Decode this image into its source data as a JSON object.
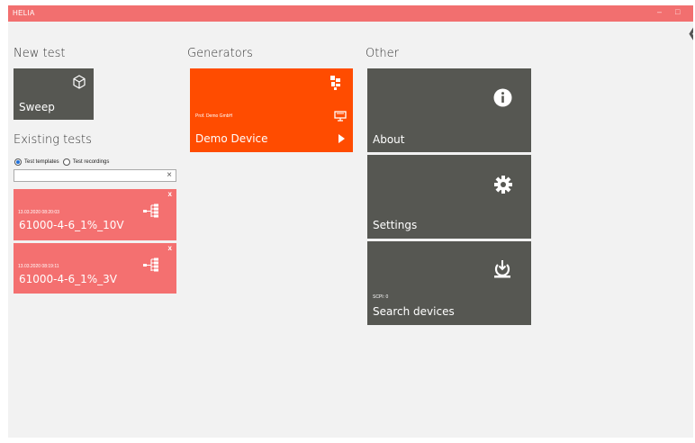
{
  "app": {
    "title": "HELIA",
    "minimize": "–",
    "maximize": "□"
  },
  "new_test": {
    "heading": "New test",
    "sweep_label": "Sweep"
  },
  "existing_tests": {
    "heading": "Existing tests",
    "radio_templates": "Test templates",
    "radio_recordings": "Test recordings",
    "search_value": "",
    "clear_icon": "×",
    "cards": [
      {
        "date": "13.03.2020 08:20:03",
        "name": "61000-4-6_1%_10V",
        "close": "x"
      },
      {
        "date": "13.03.2020 08:19:11",
        "name": "61000-4-6_1%_3V",
        "close": "x"
      }
    ]
  },
  "generators": {
    "heading": "Generators",
    "device_company": "Prof. Demo GmbH",
    "device_name": "Demo Device"
  },
  "other": {
    "heading": "Other",
    "about": "About",
    "settings": "Settings",
    "search_devices": "Search devices",
    "scpi": "SCPI: 0"
  },
  "colors": {
    "titlebar": "#f26f6f",
    "tile_gray": "#565752",
    "tile_orange": "#ff4c00",
    "card_red": "#f47070"
  },
  "icons": {
    "sweep": "cube-icon",
    "generator": "device-icon",
    "about": "info-icon",
    "settings": "gear-icon",
    "search": "download-icon",
    "card": "hierarchy-icon"
  }
}
